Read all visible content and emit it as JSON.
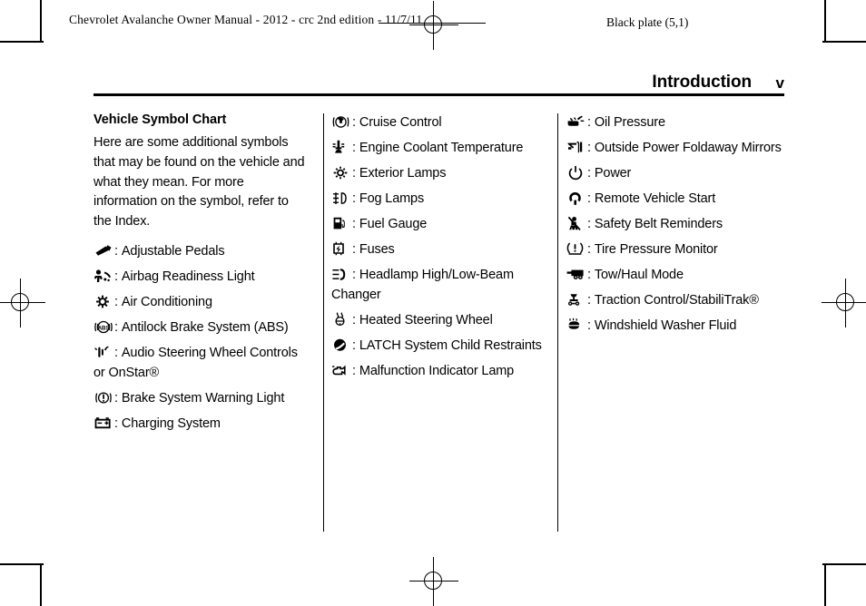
{
  "print_marks": {
    "slug": "Chevrolet Avalanche Owner Manual - 2012 - crc 2nd edition - 11/7/11",
    "black_plate": "Black plate (5,1)"
  },
  "header": {
    "title": "Introduction",
    "folio": "v"
  },
  "colors": {
    "ink": "#000000",
    "paper": "#ffffff"
  },
  "columns": [
    {
      "section_title": "Vehicle Symbol Chart",
      "intro": "Here are some additional symbols that may be found on the vehicle and what they mean. For more information on the symbol, refer to the Index.",
      "items": [
        {
          "icon": "adjustable-pedals-icon",
          "colon": ":",
          "label": "Adjustable Pedals"
        },
        {
          "icon": "airbag-readiness-light-icon",
          "colon": ":",
          "label": "Airbag Readiness Light"
        },
        {
          "icon": "air-conditioning-icon",
          "colon": ":",
          "label": "Air Conditioning"
        },
        {
          "icon": "antilock-brake-system-icon",
          "colon": ":",
          "label": "Antilock Brake System (ABS)"
        },
        {
          "icon": "audio-steering-wheel-controls-icon",
          "colon": ":",
          "label": "Audio Steering Wheel Controls or OnStar®"
        },
        {
          "icon": "brake-system-warning-light-icon",
          "colon": ":",
          "label": "Brake System Warning Light"
        },
        {
          "icon": "charging-system-icon",
          "colon": ":",
          "label": "Charging System"
        }
      ]
    },
    {
      "section_title": "",
      "intro": "",
      "items": [
        {
          "icon": "cruise-control-icon",
          "colon": ":",
          "label": "Cruise Control"
        },
        {
          "icon": "engine-coolant-temperature-icon",
          "colon": ":",
          "label": "Engine Coolant Temperature"
        },
        {
          "icon": "exterior-lamps-icon",
          "colon": ":",
          "label": "Exterior Lamps"
        },
        {
          "icon": "fog-lamps-icon",
          "colon": ":",
          "label": "Fog Lamps"
        },
        {
          "icon": "fuel-gauge-icon",
          "colon": ":",
          "label": "Fuel Gauge"
        },
        {
          "icon": "fuses-icon",
          "colon": ":",
          "label": "Fuses"
        },
        {
          "icon": "headlamp-high-low-beam-changer-icon",
          "colon": ":",
          "label": "Headlamp High/Low-Beam Changer"
        },
        {
          "icon": "heated-steering-wheel-icon",
          "colon": ":",
          "label": "Heated Steering Wheel"
        },
        {
          "icon": "latch-system-child-restraints-icon",
          "colon": ":",
          "label": "LATCH System Child Restraints"
        },
        {
          "icon": "malfunction-indicator-lamp-icon",
          "colon": ":",
          "label": "Malfunction Indicator Lamp"
        }
      ]
    },
    {
      "section_title": "",
      "intro": "",
      "items": [
        {
          "icon": "oil-pressure-icon",
          "colon": ":",
          "label": "Oil Pressure"
        },
        {
          "icon": "outside-power-foldaway-mirrors-icon",
          "colon": ":",
          "label": "Outside Power Foldaway Mirrors"
        },
        {
          "icon": "power-icon",
          "colon": ":",
          "label": "Power"
        },
        {
          "icon": "remote-vehicle-start-icon",
          "colon": ":",
          "label": "Remote Vehicle Start"
        },
        {
          "icon": "safety-belt-reminders-icon",
          "colon": ":",
          "label": "Safety Belt Reminders"
        },
        {
          "icon": "tire-pressure-monitor-icon",
          "colon": ":",
          "label": "Tire Pressure Monitor"
        },
        {
          "icon": "tow-haul-mode-icon",
          "colon": ":",
          "label": "Tow/Haul Mode"
        },
        {
          "icon": "traction-control-stabilitrak-icon",
          "colon": ":",
          "label": "Traction Control/StabiliTrak®"
        },
        {
          "icon": "windshield-washer-fluid-icon",
          "colon": ":",
          "label": "Windshield Washer Fluid"
        }
      ]
    }
  ]
}
